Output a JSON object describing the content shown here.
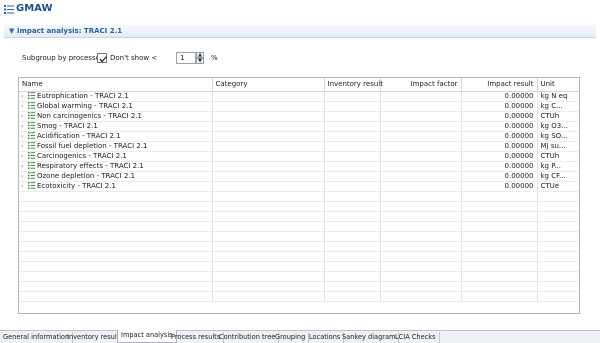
{
  "app": {
    "title": "GMAW"
  },
  "section": {
    "title": "Impact analysis: TRACI 2.1"
  },
  "controls": {
    "subgroup_label": "Subgroup by processes",
    "dont_show_label": "Don't show <",
    "dont_show_checked": true,
    "threshold_value": "1",
    "percent_label": "%"
  },
  "table": {
    "columns": [
      "Name",
      "Category",
      "Inventory result",
      "Impact factor",
      "Impact result",
      "Unit"
    ],
    "rows": [
      {
        "name": "Eutrophication - TRACI 2.1",
        "impact_result": "0.00000",
        "unit": "kg N eq"
      },
      {
        "name": "Global warming - TRACI 2.1",
        "impact_result": "0.00000",
        "unit": "kg C..."
      },
      {
        "name": "Non carcinogenics - TRACI 2.1",
        "impact_result": "0.00000",
        "unit": "CTUh"
      },
      {
        "name": "Smog - TRACI 2.1",
        "impact_result": "0.00000",
        "unit": "kg O3..."
      },
      {
        "name": "Acidification - TRACI 2.1",
        "impact_result": "0.00000",
        "unit": "kg SO..."
      },
      {
        "name": "Fossil fuel depletion - TRACI 2.1",
        "impact_result": "0.00000",
        "unit": "MJ su..."
      },
      {
        "name": "Carcinogenics - TRACI 2.1",
        "impact_result": "0.00000",
        "unit": "CTUh"
      },
      {
        "name": "Respiratory effects - TRACI 2.1",
        "impact_result": "0.00000",
        "unit": "kg P..."
      },
      {
        "name": "Ozone depletion - TRACI 2.1",
        "impact_result": "0.00000",
        "unit": "kg CF..."
      },
      {
        "name": "Ecotoxicity - TRACI 2.1",
        "impact_result": "0.00000",
        "unit": "CTUe"
      }
    ]
  },
  "tabs": [
    {
      "label": "General information",
      "active": false
    },
    {
      "label": "Inventory results",
      "active": false
    },
    {
      "label": "Impact analysis",
      "active": true
    },
    {
      "label": "Process results",
      "active": false
    },
    {
      "label": "Contribution tree",
      "active": false
    },
    {
      "label": "Grouping",
      "active": false
    },
    {
      "label": "Locations",
      "active": false
    },
    {
      "label": "Sankey diagram",
      "active": false
    },
    {
      "label": "LCIA Checks",
      "active": false
    }
  ],
  "colors": {
    "title": "#1f4e8c",
    "section": "#2b62a6",
    "tree_icon": "#3b8c3b"
  },
  "icons": {
    "app": "editor-list-icon",
    "row": "tree-list-icon",
    "expand": "chevron-right-icon",
    "section": "chevron-down-icon"
  }
}
